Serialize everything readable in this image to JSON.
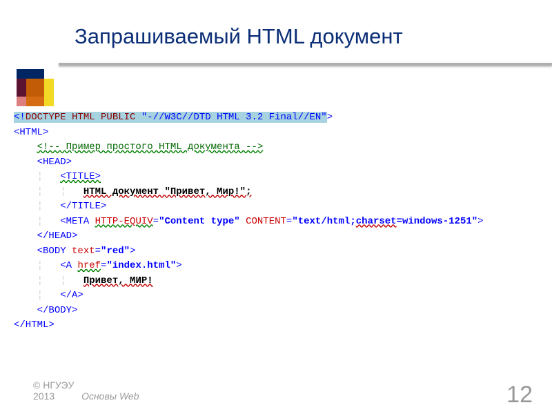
{
  "title": "Запрашиваемый HTML документ",
  "code": {
    "l1a": "<!",
    "l1b": "DOCTYPE HTML PUBLIC ",
    "l1c": "\"-//W3C//DTD HTML 3.2 Final//EN\"",
    "l1d": ">",
    "l2": "<HTML>",
    "l3": "<!-- Пример простого HTML документа -->",
    "l4": "<HEAD>",
    "l5": "<TITLE>",
    "l6": "HTML документ \"Привет, Мир!\";",
    "l7": "</TITLE>",
    "l8a": "<META ",
    "l8b": "HTTP-EQUIV",
    "l8c": "=",
    "l8d": "\"Content type\"",
    "l8e": " CONTENT",
    "l8f": "=",
    "l8g": "\"text/html;",
    "l8h": "charset",
    "l8i": "=windows-1251\"",
    "l8j": ">",
    "l9": "</HEAD>",
    "l10a": "<BODY ",
    "l10b": "text",
    "l10c": "=",
    "l10d": "\"red\"",
    "l10e": ">",
    "l11a": "<A ",
    "l11b": "href",
    "l11c": "=",
    "l11d": "\"index.html\"",
    "l11e": ">",
    "l12": "Привет, МИР!",
    "l13": "</A>",
    "l14": "</BODY>",
    "l15": "</HTML>"
  },
  "footer": {
    "copyright": "© НГУЭУ",
    "year": "2013",
    "course": "Основы Web"
  },
  "page": "12"
}
